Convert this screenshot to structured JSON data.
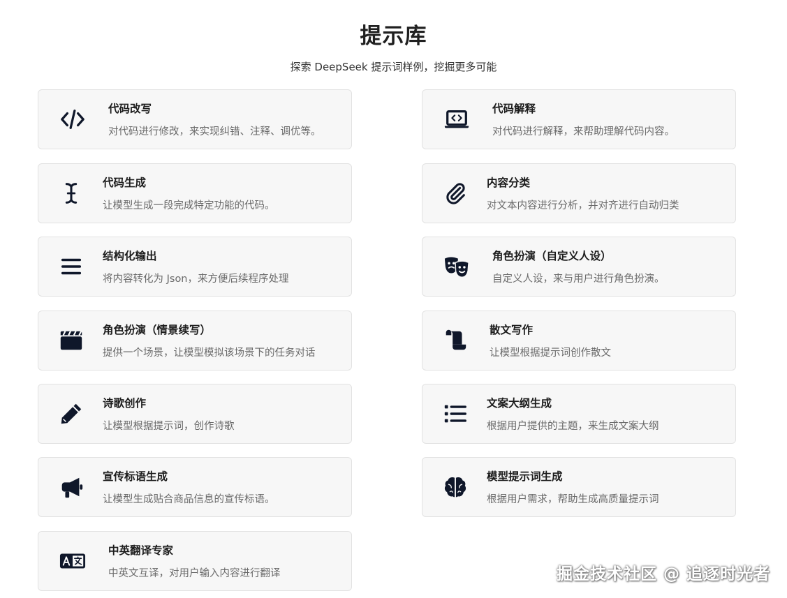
{
  "header": {
    "title": "提示库",
    "subtitle": "探索 DeepSeek 提示词样例，挖掘更多可能"
  },
  "cards": [
    {
      "title": "代码改写",
      "desc": "对代码进行修改，来实现纠错、注释、调优等。",
      "icon": "code-icon"
    },
    {
      "title": "代码解释",
      "desc": "对代码进行解释，来帮助理解代码内容。",
      "icon": "laptop-code-icon"
    },
    {
      "title": "代码生成",
      "desc": "让模型生成一段完成特定功能的代码。",
      "icon": "text-cursor-icon"
    },
    {
      "title": "内容分类",
      "desc": "对文本内容进行分析，并对齐进行自动归类",
      "icon": "paperclip-icon"
    },
    {
      "title": "结构化输出",
      "desc": "将内容转化为 Json，来方便后续程序处理",
      "icon": "bars-icon"
    },
    {
      "title": "角色扮演（自定义人设）",
      "desc": "自定义人设，来与用户进行角色扮演。",
      "icon": "theater-masks-icon"
    },
    {
      "title": "角色扮演（情景续写）",
      "desc": "提供一个场景，让模型模拟该场景下的任务对话",
      "icon": "clapperboard-icon"
    },
    {
      "title": "散文写作",
      "desc": "让模型根据提示词创作散文",
      "icon": "scroll-icon"
    },
    {
      "title": "诗歌创作",
      "desc": "让模型根据提示词，创作诗歌",
      "icon": "pencil-icon"
    },
    {
      "title": "文案大纲生成",
      "desc": "根据用户提供的主题，来生成文案大纲",
      "icon": "list-icon"
    },
    {
      "title": "宣传标语生成",
      "desc": "让模型生成贴合商品信息的宣传标语。",
      "icon": "bullhorn-icon"
    },
    {
      "title": "模型提示词生成",
      "desc": "根据用户需求，帮助生成高质量提示词",
      "icon": "brain-icon"
    },
    {
      "title": "中英翻译专家",
      "desc": "中英文互译，对用户输入内容进行翻译",
      "icon": "language-icon"
    }
  ],
  "watermark": "掘金技术社区 @ 追逐时光者",
  "colors": {
    "card_bg": "#f7f7f7",
    "card_border": "#e2e2e2",
    "icon": "#0f172a"
  }
}
